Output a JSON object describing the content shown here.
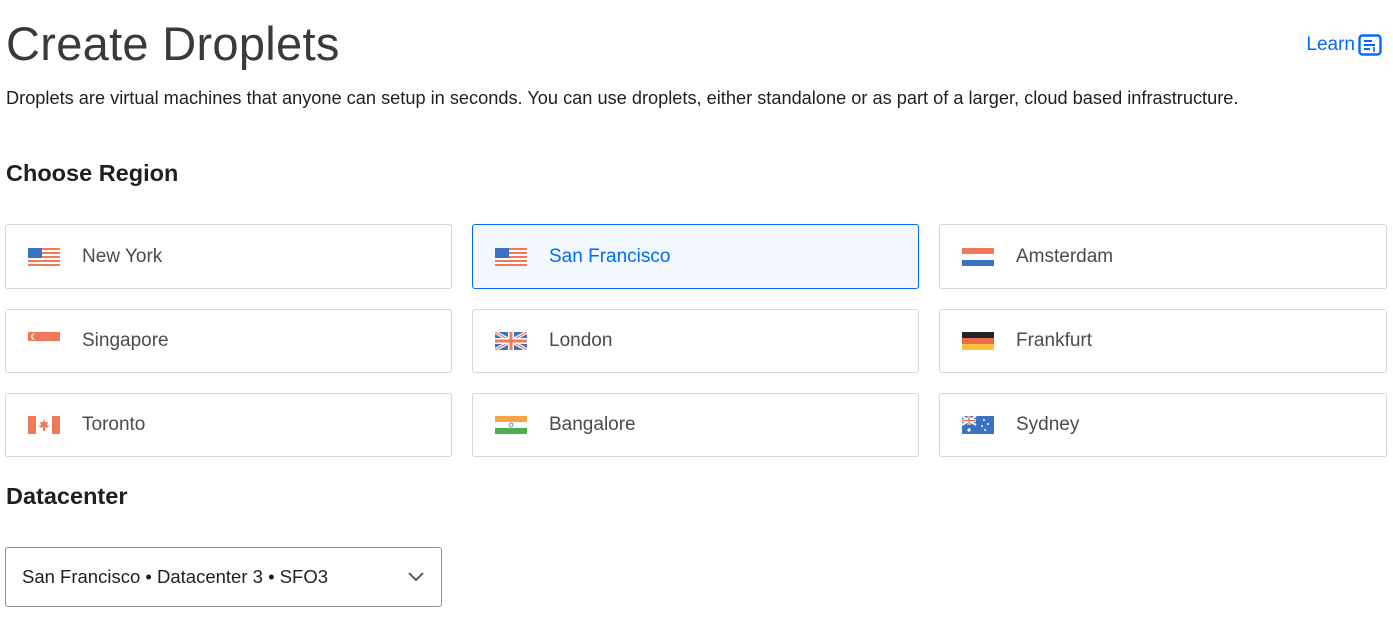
{
  "header": {
    "title": "Create Droplets",
    "learn_label": "Learn",
    "description": "Droplets are virtual machines that anyone can setup in seconds. You can use droplets, either standalone or as part of a larger, cloud based infrastructure."
  },
  "region_section": {
    "title": "Choose Region",
    "selected": "San Francisco",
    "regions": [
      {
        "label": "New York",
        "flag": "us-flag-icon"
      },
      {
        "label": "San Francisco",
        "flag": "us-flag-icon"
      },
      {
        "label": "Amsterdam",
        "flag": "nl-flag-icon"
      },
      {
        "label": "Singapore",
        "flag": "sg-flag-icon"
      },
      {
        "label": "London",
        "flag": "uk-flag-icon"
      },
      {
        "label": "Frankfurt",
        "flag": "de-flag-icon"
      },
      {
        "label": "Toronto",
        "flag": "ca-flag-icon"
      },
      {
        "label": "Bangalore",
        "flag": "in-flag-icon"
      },
      {
        "label": "Sydney",
        "flag": "au-flag-icon"
      }
    ]
  },
  "datacenter_section": {
    "title": "Datacenter",
    "selected_value": "San Francisco • Datacenter 3 • SFO3"
  },
  "colors": {
    "accent": "#0069ff",
    "selected_bg": "#f3f8ff",
    "border": "#d6d6d6"
  }
}
